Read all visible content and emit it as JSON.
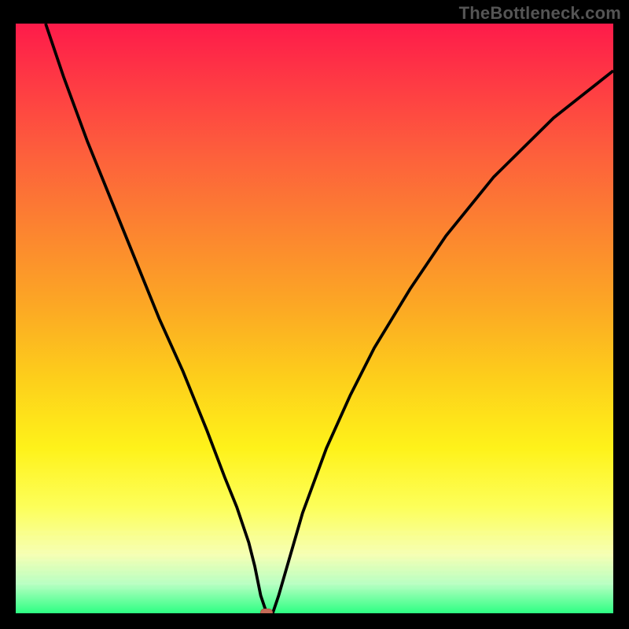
{
  "watermark": "TheBottleneck.com",
  "colors": {
    "curve_stroke": "#000000",
    "marker_fill": "#c66a57",
    "plot_border": "#000000"
  },
  "chart_data": {
    "type": "line",
    "title": "",
    "xlabel": "",
    "ylabel": "",
    "xlim": [
      0,
      100
    ],
    "ylim": [
      0,
      100
    ],
    "bottleneck_point": {
      "x": 42,
      "y": 0
    },
    "series": [
      {
        "name": "bottleneck-curve",
        "x": [
          5,
          8,
          12,
          16,
          20,
          24,
          28,
          32,
          35,
          37,
          39,
          40,
          41,
          42,
          43,
          44,
          46,
          48,
          52,
          56,
          60,
          66,
          72,
          80,
          90,
          100
        ],
        "values": [
          100,
          91,
          80,
          70,
          60,
          50,
          41,
          31,
          23,
          18,
          12,
          8,
          3,
          0,
          0,
          3,
          10,
          17,
          28,
          37,
          45,
          55,
          64,
          74,
          84,
          92
        ]
      }
    ],
    "grid": false,
    "legend": false
  }
}
